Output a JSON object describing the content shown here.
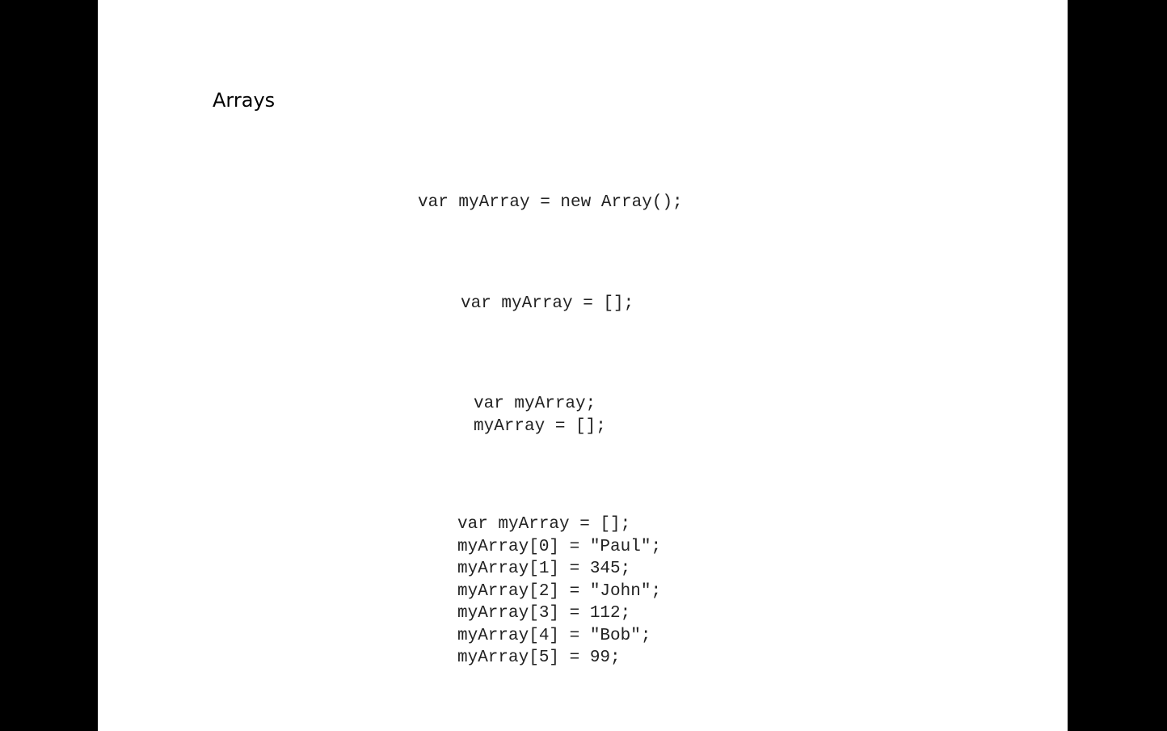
{
  "slide": {
    "title": "Arrays",
    "code_blocks": [
      {
        "lines": [
          "var myArray = new Array();"
        ]
      },
      {
        "lines": [
          "var myArray = [];"
        ]
      },
      {
        "lines": [
          "var myArray;",
          "myArray = [];"
        ]
      },
      {
        "lines": [
          "var myArray = [];",
          "myArray[0] = \"Paul\";",
          "myArray[1] = 345;",
          "myArray[2] = \"John\";",
          "myArray[3] = 112;",
          "myArray[4] = \"Bob\";",
          "myArray[5] = 99;"
        ]
      }
    ]
  }
}
